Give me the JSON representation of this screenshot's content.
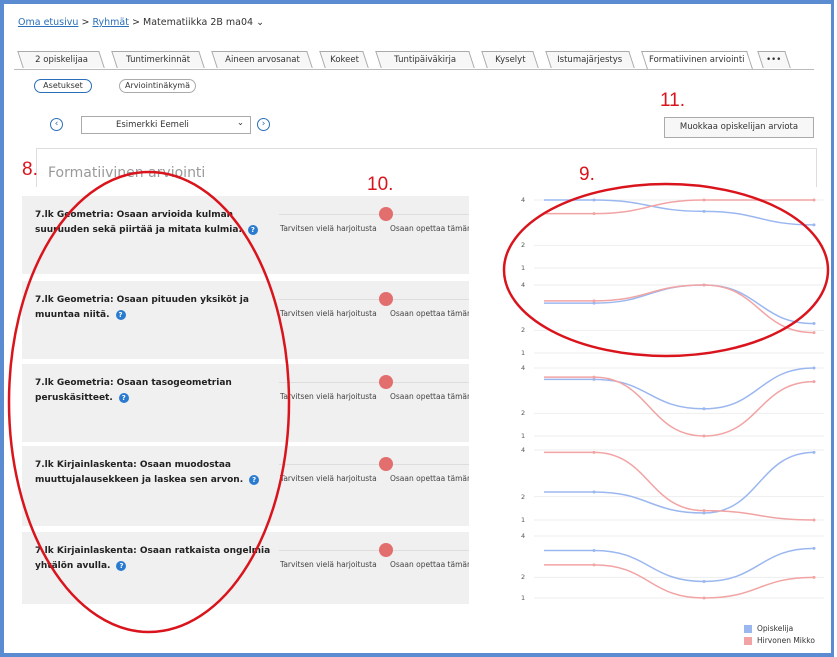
{
  "breadcrumb": {
    "home": "Oma etusivu",
    "sep1": ">",
    "groups": "Ryhmät",
    "sep2": ">",
    "current": "Matematiikka 2B ma04",
    "chev": "⌄"
  },
  "tabs": [
    "2 opiskelijaa",
    "Tuntimerkinnät",
    "Aineen arvosanat",
    "Kokeet",
    "Tuntipäiväkirja",
    "Kyselyt",
    "Istumajärjestys",
    "Formatiivinen arviointi",
    "•••"
  ],
  "subtabs": {
    "settings": "Asetukset",
    "view": "Arviointinäkymä"
  },
  "student_select": {
    "value": "Esimerkki Eemeli",
    "prev": "‹",
    "next": "›",
    "caret": "⌄"
  },
  "edit_button": "Muokkaa opiskelijan arviota",
  "section_title": "Formatiivinen arviointi",
  "annotations": {
    "a8": "8.",
    "a9": "9.",
    "a10": "10.",
    "a11": "11."
  },
  "slider_labels": {
    "left": "Tarvitsen vielä harjoitusta",
    "right": "Osaan opettaa tämän muille"
  },
  "help_icon": "?",
  "rows": [
    {
      "line1": "7.lk Geometria: Osaan arvioida kulman",
      "line2": "suuruuden sekä piirtää ja mitata kulmia."
    },
    {
      "line1": "7.lk Geometria: Osaan pituuden yksiköt ja",
      "line2": "muuntaa niitä."
    },
    {
      "line1": "7.lk Geometria: Osaan tasogeometrian",
      "line2": "peruskäsitteet."
    },
    {
      "line1": "7.lk Kirjainlaskenta: Osaan muodostaa",
      "line2": "muuttujalausekkeen ja laskea sen arvon."
    },
    {
      "line1": "7.lk Kirjainlaskenta: Osaan ratkaista ongelmia",
      "line2": "yhtälön avulla."
    }
  ],
  "chart_data": [
    {
      "type": "line",
      "y_ticks": [
        "4",
        "2",
        "1"
      ],
      "series": [
        {
          "name": "Opiskelija",
          "color": "#9bb7f0",
          "values": [
            4.0,
            3.5,
            2.9
          ]
        },
        {
          "name": "Hirvonen Mikko",
          "color": "#f2a3a3",
          "values": [
            3.4,
            4.0,
            4.0
          ]
        }
      ]
    },
    {
      "type": "line",
      "y_ticks": [
        "4",
        "2",
        "1"
      ],
      "series": [
        {
          "name": "Opiskelija",
          "color": "#9bb7f0",
          "values": [
            3.2,
            4.0,
            2.3
          ]
        },
        {
          "name": "Hirvonen Mikko",
          "color": "#f2a3a3",
          "values": [
            3.3,
            4.0,
            1.9
          ]
        }
      ]
    },
    {
      "type": "line",
      "y_ticks": [
        "4",
        "2",
        "1"
      ],
      "series": [
        {
          "name": "Opiskelija",
          "color": "#9bb7f0",
          "values": [
            3.5,
            2.2,
            4.0
          ]
        },
        {
          "name": "Hirvonen Mikko",
          "color": "#f2a3a3",
          "values": [
            3.6,
            1.0,
            3.4
          ]
        }
      ]
    },
    {
      "type": "line",
      "y_ticks": [
        "4",
        "2",
        "1"
      ],
      "series": [
        {
          "name": "Opiskelija",
          "color": "#9bb7f0",
          "values": [
            2.2,
            1.3,
            3.9
          ]
        },
        {
          "name": "Hirvonen Mikko",
          "color": "#f2a3a3",
          "values": [
            3.9,
            1.4,
            1.0
          ]
        }
      ]
    },
    {
      "type": "line",
      "y_ticks": [
        "4",
        "2",
        "1"
      ],
      "series": [
        {
          "name": "Opiskelija",
          "color": "#9bb7f0",
          "values": [
            3.3,
            1.8,
            3.4
          ]
        },
        {
          "name": "Hirvonen Mikko",
          "color": "#f2a3a3",
          "values": [
            2.6,
            1.0,
            2.0
          ]
        }
      ]
    }
  ],
  "legend": [
    {
      "label": "Opiskelija",
      "color": "#9bb7f0"
    },
    {
      "label": "Hirvonen Mikko",
      "color": "#f2a3a3"
    }
  ],
  "colors": {
    "annotation": "#d9141c",
    "knob": "#e26e6e",
    "accent": "#2a6fb9"
  }
}
